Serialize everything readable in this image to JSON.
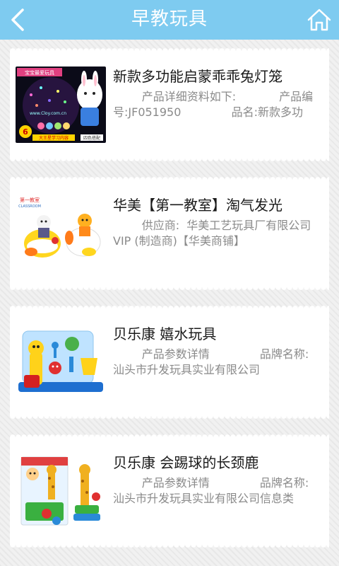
{
  "header": {
    "title": "早教玩具",
    "back_icon": "chevron-left-icon",
    "home_icon": "home-icon",
    "bg_color": "#7ecbf0"
  },
  "products": [
    {
      "title": "新款多功能启蒙乖乖兔灯笼",
      "desc": "        产品详细资料如下:            产品编号:JF051950              品名:新款多功",
      "image": {
        "banner": "宝宝最爱玩具",
        "badge": "6",
        "site": "www.Cloy.com.cn",
        "strip": "大王星学习内容",
        "tag": "四色搭配"
      }
    },
    {
      "title": "华美【第一教室】淘气发光",
      "desc": "        供应商:  华美工艺玩具厂有限公司VIP (制造商)【华美商铺】",
      "image": {
        "logo": "第一教室",
        "logo_sub": "CLASSROOM"
      }
    },
    {
      "title": "贝乐康 嬉水玩具",
      "desc": "        产品参数详情              品牌名称:汕头市升发玩具实业有限公司",
      "image": {}
    },
    {
      "title": "贝乐康 会踢球的长颈鹿",
      "desc": "        产品参数详情              品牌名称:汕头市升发玩具实业有限公司信息类",
      "image": {}
    }
  ]
}
